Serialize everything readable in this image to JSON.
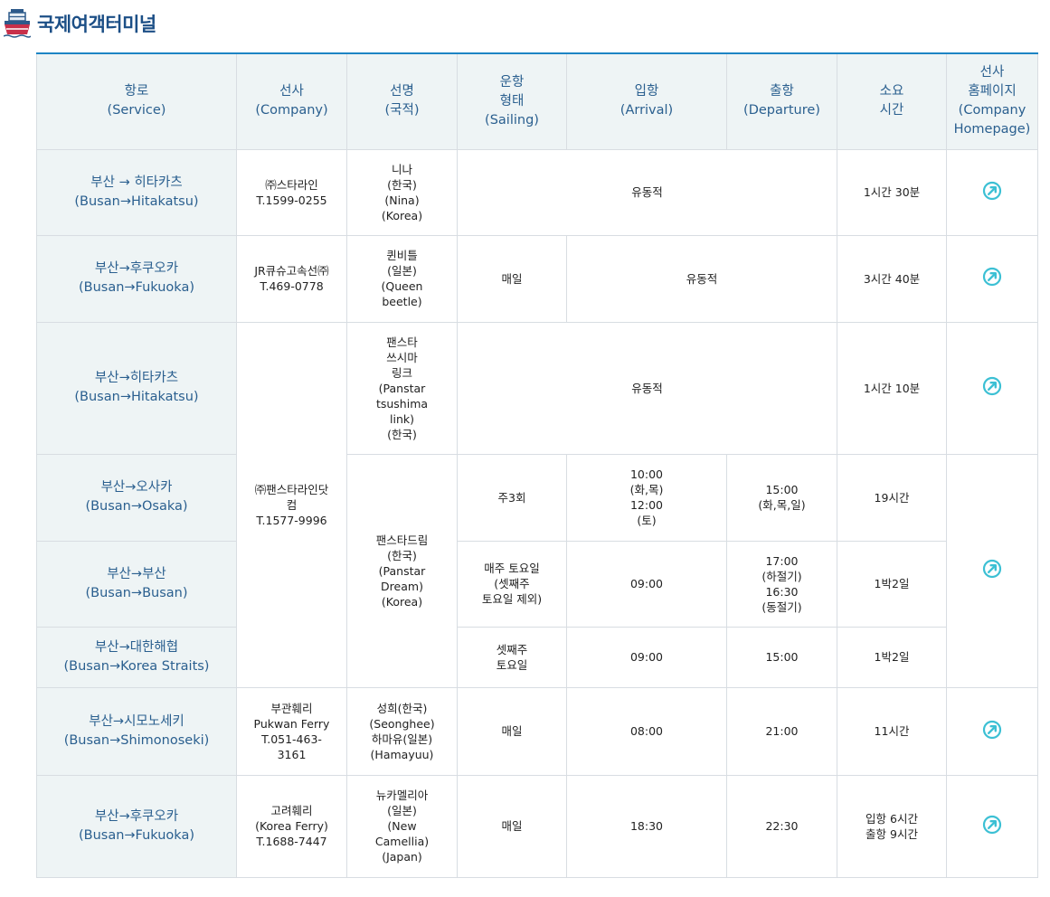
{
  "page": {
    "title": "국제여객터미널"
  },
  "header": {
    "service": [
      "항로",
      "(Service)"
    ],
    "company": [
      "선사",
      "(Company)"
    ],
    "ship": [
      "선명",
      "(국적)"
    ],
    "sailing": [
      "운항",
      "형태",
      "(Sailing)"
    ],
    "arrival": [
      "입항",
      "(Arrival)"
    ],
    "departure": [
      "출항",
      "(Departure)"
    ],
    "duration": [
      "소요",
      "시간"
    ],
    "homepage": [
      "선사",
      "홈페이지",
      "(Company",
      "Homepage)"
    ]
  },
  "rows": [
    {
      "service": [
        "부산 → 히타카츠",
        "(Busan→Hitakatsu)"
      ],
      "company": [
        "㈜스타라인",
        "T.1599-0255"
      ],
      "ship": [
        "니나",
        "(한국)",
        "(Nina)",
        "(Korea)"
      ],
      "schedule": "유동적",
      "duration": [
        "1시간 30분"
      ]
    },
    {
      "service": [
        "부산→후쿠오카",
        "(Busan→Fukuoka)"
      ],
      "company": [
        "JR큐슈고속선㈜",
        "T.469-0778"
      ],
      "ship": [
        "퀸비틀",
        "(일본)",
        "(Queen",
        "beetle)"
      ],
      "sailing": [
        "매일"
      ],
      "schedule": "유동적",
      "duration": [
        "3시간 40분"
      ]
    },
    {
      "service": [
        "부산→히타카츠",
        "(Busan→Hitakatsu)"
      ],
      "ship": [
        "팬스타",
        "쓰시마",
        "링크",
        "(Panstar",
        "tsushima",
        "link)",
        "(한국)"
      ],
      "schedule": "유동적",
      "duration": [
        "1시간 10분"
      ]
    },
    {
      "service": [
        "부산→오사카",
        "(Busan→Osaka)"
      ],
      "sailing": [
        "주3회"
      ],
      "arrival": [
        "10:00",
        "(화,목)",
        "12:00",
        "(토)"
      ],
      "departure": [
        "15:00",
        "(화,목,일)"
      ],
      "duration": [
        "19시간"
      ]
    },
    {
      "service": [
        "부산→부산",
        "(Busan→Busan)"
      ],
      "sailing": [
        "매주 토요일",
        "(셋째주",
        "토요일 제외)"
      ],
      "arrival": [
        "09:00"
      ],
      "departure": [
        "17:00",
        "(하절기)",
        "16:30",
        "(동절기)"
      ],
      "duration": [
        "1박2일"
      ]
    },
    {
      "service": [
        "부산→대한해협",
        "(Busan→Korea Straits)"
      ],
      "sailing": [
        "셋째주",
        "토요일"
      ],
      "arrival": [
        "09:00"
      ],
      "departure": [
        "15:00"
      ],
      "duration": [
        "1박2일"
      ]
    },
    {
      "service": [
        "부산→시모노세키",
        "(Busan→Shimonoseki)"
      ],
      "company": [
        "부관훼리",
        "Pukwan Ferry",
        "T.051-463-",
        "3161"
      ],
      "ship": [
        "성희(한국)",
        "(Seonghee)",
        "하마유(일본)",
        "(Hamayuu)"
      ],
      "sailing": [
        "매일"
      ],
      "arrival": [
        "08:00"
      ],
      "departure": [
        "21:00"
      ],
      "duration": [
        "11시간"
      ]
    },
    {
      "service": [
        "부산→후쿠오카",
        "(Busan→Fukuoka)"
      ],
      "company": [
        "고려훼리",
        "(Korea Ferry)",
        "T.1688-7447"
      ],
      "ship": [
        "뉴카멜리아",
        "(일본)",
        "(New",
        "Camellia)",
        "(Japan)"
      ],
      "sailing": [
        "매일"
      ],
      "arrival": [
        "18:30"
      ],
      "departure": [
        "22:30"
      ],
      "duration": [
        "입항 6시간",
        "출항 9시간"
      ]
    }
  ],
  "panstar": {
    "company": [
      "㈜팬스타라인닷",
      "컴",
      "T.1577-9996"
    ],
    "ship_dream": [
      "팬스타드림",
      "(한국)",
      "(Panstar",
      "Dream)",
      "(Korea)"
    ]
  },
  "icons": {
    "link": "external-link-icon",
    "ship": "ship-icon"
  },
  "colors": {
    "accent": "#1d84c4",
    "header_bg": "#eef4f5",
    "title": "#1c4f86",
    "link_icon": "#3cc0d4"
  }
}
